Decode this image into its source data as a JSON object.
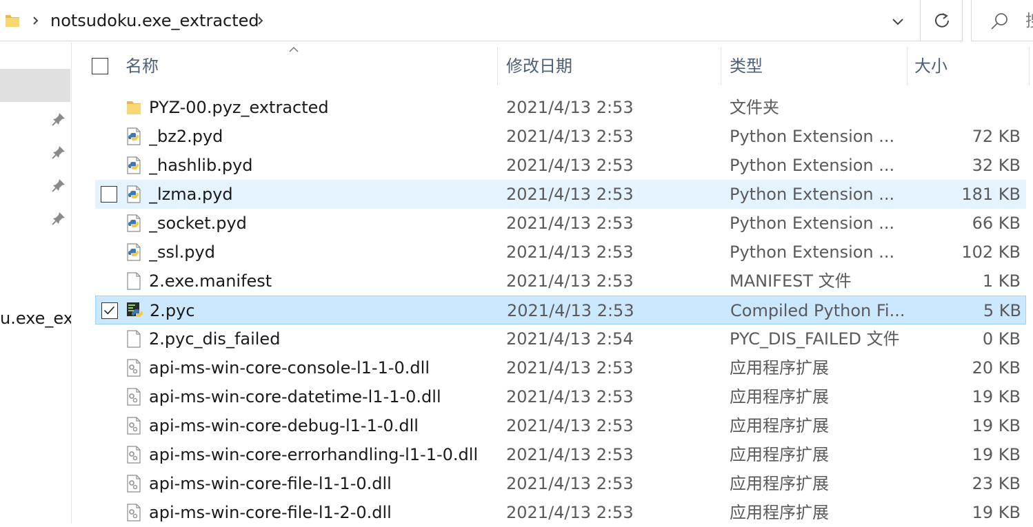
{
  "address_bar": {
    "path_segment": "notsudoku.exe_extracted",
    "search_placeholder": "搜"
  },
  "nav_pane": {
    "truncated_item_label": "u.exe_ext"
  },
  "columns": {
    "name": "名称",
    "date": "修改日期",
    "type": "类型",
    "size": "大小"
  },
  "files": [
    {
      "name": "PYZ-00.pyz_extracted",
      "date": "2021/4/13 2:53",
      "type": "文件夹",
      "size": "",
      "icon": "folder-icon"
    },
    {
      "name": "_bz2.pyd",
      "date": "2021/4/13 2:53",
      "type": "Python Extension ...",
      "size": "72 KB",
      "icon": "python-file-icon"
    },
    {
      "name": "_hashlib.pyd",
      "date": "2021/4/13 2:53",
      "type": "Python Extension ...",
      "size": "32 KB",
      "icon": "python-file-icon"
    },
    {
      "name": "_lzma.pyd",
      "date": "2021/4/13 2:53",
      "type": "Python Extension ...",
      "size": "181 KB",
      "icon": "python-file-icon"
    },
    {
      "name": "_socket.pyd",
      "date": "2021/4/13 2:53",
      "type": "Python Extension ...",
      "size": "66 KB",
      "icon": "python-file-icon"
    },
    {
      "name": "_ssl.pyd",
      "date": "2021/4/13 2:53",
      "type": "Python Extension ...",
      "size": "102 KB",
      "icon": "python-file-icon"
    },
    {
      "name": "2.exe.manifest",
      "date": "2021/4/13 2:53",
      "type": "MANIFEST 文件",
      "size": "1 KB",
      "icon": "blank-file-icon"
    },
    {
      "name": "2.pyc",
      "date": "2021/4/13 2:53",
      "type": "Compiled Python Fi...",
      "size": "5 KB",
      "icon": "compiled-python-icon"
    },
    {
      "name": "2.pyc_dis_failed",
      "date": "2021/4/13 2:54",
      "type": "PYC_DIS_FAILED 文件",
      "size": "0 KB",
      "icon": "blank-file-icon"
    },
    {
      "name": "api-ms-win-core-console-l1-1-0.dll",
      "date": "2021/4/13 2:53",
      "type": "应用程序扩展",
      "size": "20 KB",
      "icon": "dll-file-icon"
    },
    {
      "name": "api-ms-win-core-datetime-l1-1-0.dll",
      "date": "2021/4/13 2:53",
      "type": "应用程序扩展",
      "size": "19 KB",
      "icon": "dll-file-icon"
    },
    {
      "name": "api-ms-win-core-debug-l1-1-0.dll",
      "date": "2021/4/13 2:53",
      "type": "应用程序扩展",
      "size": "19 KB",
      "icon": "dll-file-icon"
    },
    {
      "name": "api-ms-win-core-errorhandling-l1-1-0.dll",
      "date": "2021/4/13 2:53",
      "type": "应用程序扩展",
      "size": "19 KB",
      "icon": "dll-file-icon"
    },
    {
      "name": "api-ms-win-core-file-l1-1-0.dll",
      "date": "2021/4/13 2:53",
      "type": "应用程序扩展",
      "size": "23 KB",
      "icon": "dll-file-icon"
    },
    {
      "name": "api-ms-win-core-file-l1-2-0.dll",
      "date": "2021/4/13 2:53",
      "type": "应用程序扩展",
      "size": "19 KB",
      "icon": "dll-file-icon"
    }
  ],
  "row_states": {
    "hover_row": "_lzma.pyd",
    "selected_row": "2.pyc"
  },
  "colors": {
    "hover": "#e5f3ff",
    "selected": "#cce8ff",
    "selected_border": "#99d1ff",
    "header_text": "#4c607a",
    "folder": "#f8d775"
  }
}
